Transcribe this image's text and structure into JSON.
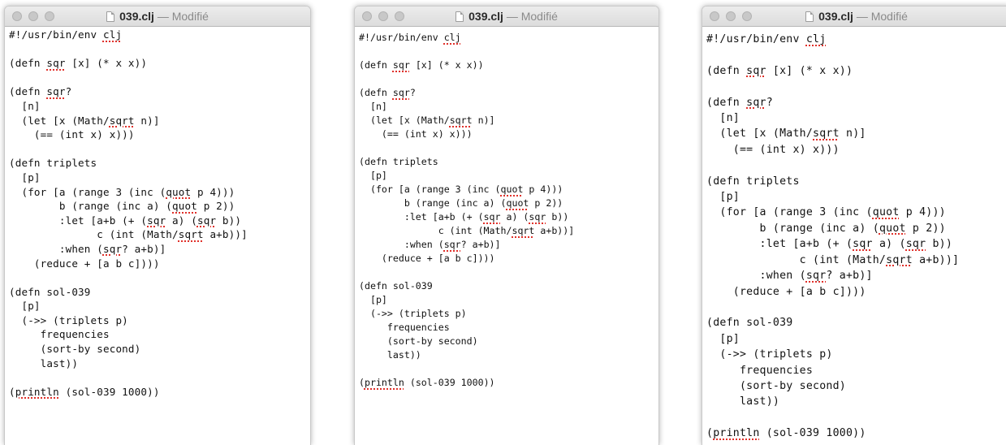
{
  "windows": [
    {
      "title": {
        "filename": "039.clj",
        "separator": " — ",
        "status": "Modifié"
      },
      "code": [
        "#!/usr/bin/env clj",
        "",
        "(defn sqr [x] (* x x))",
        "",
        "(defn sqr?",
        "  [n]",
        "  (let [x (Math/sqrt n)]",
        "    (== (int x) x)))",
        "",
        "(defn triplets",
        "  [p]",
        "  (for [a (range 3 (inc (quot p 4)))",
        "        b (range (inc a) (quot p 2))",
        "        :let [a+b (+ (sqr a) (sqr b))",
        "              c (int (Math/sqrt a+b))]",
        "        :when (sqr? a+b)]",
        "    (reduce + [a b c])))",
        "",
        "(defn sol-039",
        "  [p]",
        "  (->> (triplets p)",
        "     frequencies",
        "     (sort-by second)",
        "     last))",
        "",
        "(println (sol-039 1000))"
      ]
    },
    {
      "title": {
        "filename": "039.clj",
        "separator": " — ",
        "status": "Modifié"
      },
      "code": [
        "#!/usr/bin/env clj",
        "",
        "(defn sqr [x] (* x x))",
        "",
        "(defn sqr?",
        "  [n]",
        "  (let [x (Math/sqrt n)]",
        "    (== (int x) x)))",
        "",
        "(defn triplets",
        "  [p]",
        "  (for [a (range 3 (inc (quot p 4)))",
        "        b (range (inc a) (quot p 2))",
        "        :let [a+b (+ (sqr a) (sqr b))",
        "              c (int (Math/sqrt a+b))]",
        "        :when (sqr? a+b)]",
        "    (reduce + [a b c])))",
        "",
        "(defn sol-039",
        "  [p]",
        "  (->> (triplets p)",
        "     frequencies",
        "     (sort-by second)",
        "     last))",
        "",
        "(println (sol-039 1000))"
      ]
    },
    {
      "title": {
        "filename": "039.clj",
        "separator": " — ",
        "status": "Modifié"
      },
      "code": [
        "#!/usr/bin/env clj",
        "",
        "(defn sqr [x] (* x x))",
        "",
        "(defn sqr?",
        "  [n]",
        "  (let [x (Math/sqrt n)]",
        "    (== (int x) x)))",
        "",
        "(defn triplets",
        "  [p]",
        "  (for [a (range 3 (inc (quot p 4)))",
        "        b (range (inc a) (quot p 2))",
        "        :let [a+b (+ (sqr a) (sqr b))",
        "              c (int (Math/sqrt a+b))]",
        "        :when (sqr? a+b)]",
        "    (reduce + [a b c])))",
        "",
        "(defn sol-039",
        "  [p]",
        "  (->> (triplets p)",
        "     frequencies",
        "     (sort-by second)",
        "     last))",
        "",
        "(println (sol-039 1000))"
      ]
    }
  ],
  "spellcheck_words": [
    "clj",
    "sqr",
    "sqrt",
    "quot",
    "println"
  ],
  "colors": {
    "spellcheck_underline": "#e0302a",
    "window_chrome": "#dcdcdc"
  }
}
